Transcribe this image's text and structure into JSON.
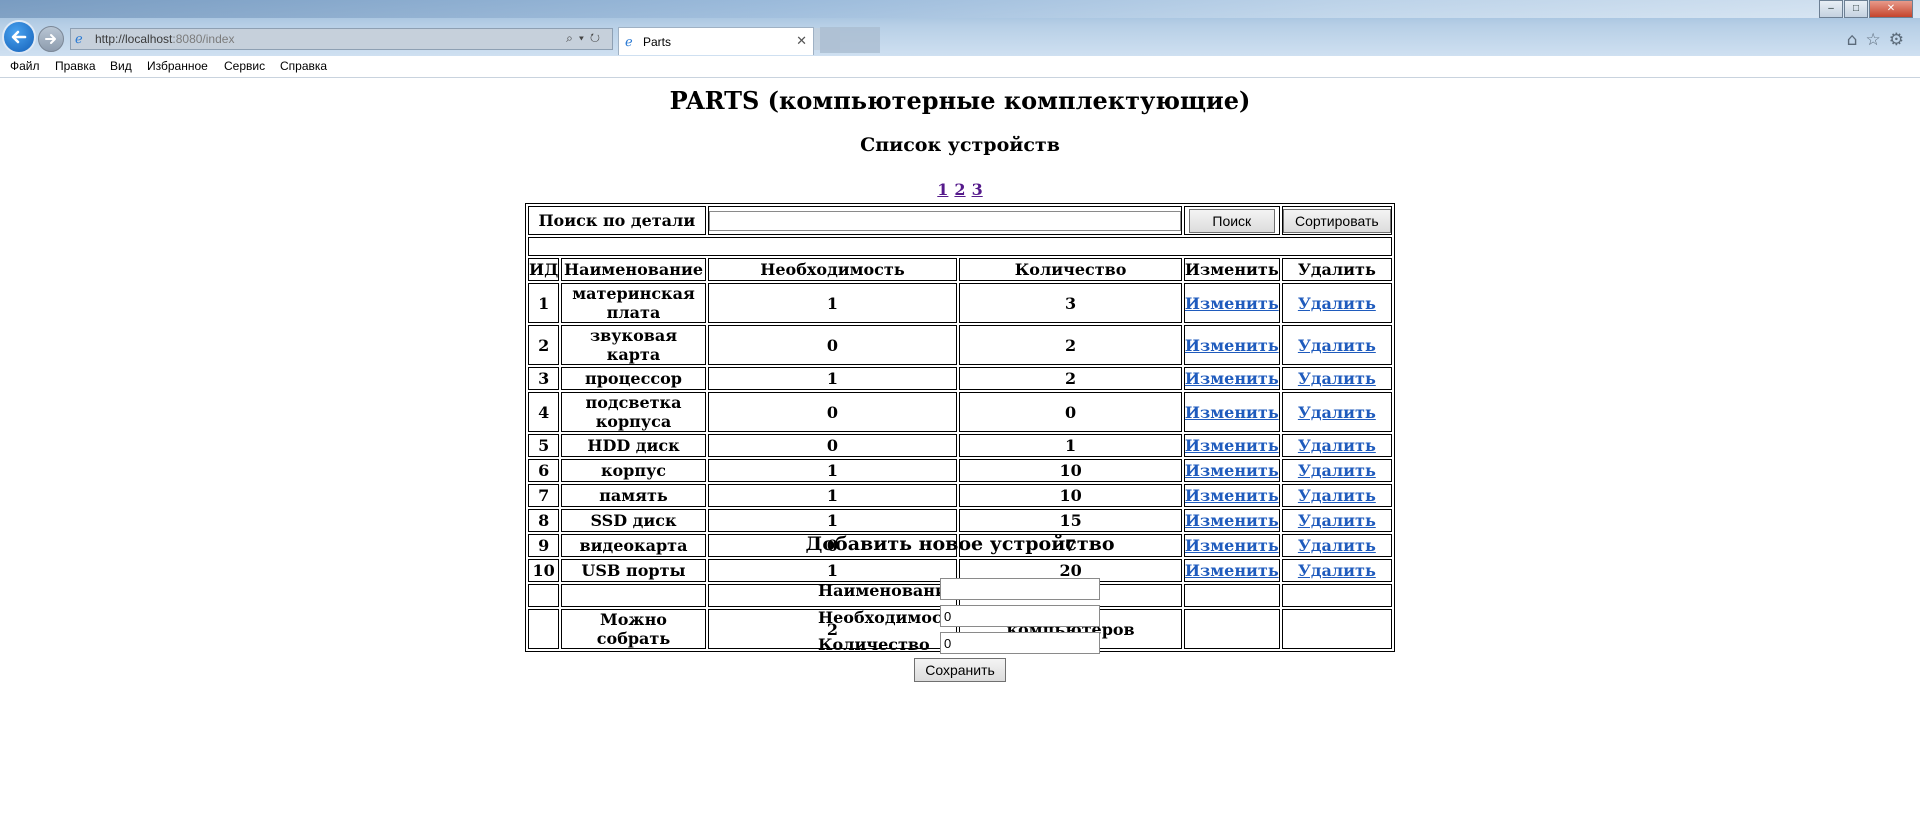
{
  "browser": {
    "url_host": "http://localhost",
    "url_path": ":8080/index",
    "tab_title": "Parts",
    "window_controls": [
      "–",
      "□",
      "✕"
    ],
    "menu": [
      "Файл",
      "Правка",
      "Вид",
      "Избранное",
      "Сервис",
      "Справка"
    ],
    "icons": [
      "back-arrow-icon",
      "forward-arrow-icon",
      "ie-logo-icon",
      "search-icon",
      "refresh-icon",
      "home-icon",
      "star-icon",
      "gear-icon",
      "close-icon"
    ]
  },
  "page": {
    "title": "PARTS (компьютерные комплектующие)",
    "subtitle": "Список устройств",
    "pages": [
      "1",
      "2",
      "3"
    ]
  },
  "search": {
    "label": "Поиск по детали",
    "value": "",
    "search_button": "Поиск",
    "sort_button": "Сортировать"
  },
  "table": {
    "headers": [
      "ИД",
      "Наименование",
      "Необходимость",
      "Количество",
      "Изменить",
      "Удалить"
    ],
    "edit_label": "Изменить",
    "delete_label": "Удалить",
    "rows": [
      {
        "id": "1",
        "name": "материнская плата",
        "need": "1",
        "qty": "3"
      },
      {
        "id": "2",
        "name": "звуковая карта",
        "need": "0",
        "qty": "2"
      },
      {
        "id": "3",
        "name": "процессор",
        "need": "1",
        "qty": "2"
      },
      {
        "id": "4",
        "name": "подсветка корпуса",
        "need": "0",
        "qty": "0"
      },
      {
        "id": "5",
        "name": "HDD диск",
        "need": "0",
        "qty": "1"
      },
      {
        "id": "6",
        "name": "корпус",
        "need": "1",
        "qty": "10"
      },
      {
        "id": "7",
        "name": "память",
        "need": "1",
        "qty": "10"
      },
      {
        "id": "8",
        "name": "SSD диск",
        "need": "1",
        "qty": "15"
      },
      {
        "id": "9",
        "name": "видеокарта",
        "need": "0",
        "qty": "7"
      },
      {
        "id": "10",
        "name": "USB порты",
        "need": "1",
        "qty": "20"
      }
    ],
    "summary": {
      "label": "Можно собрать",
      "count": "2",
      "unit": "компьютеров"
    }
  },
  "add_form": {
    "title": "Добавить новое устройство",
    "name_label": "Наименование",
    "name_value": "",
    "need_label": "Необходимость",
    "need_value": "0",
    "qty_label": "Количество",
    "qty_value": "0",
    "save_button": "Сохранить"
  },
  "colors": {
    "link": "#1f5bbd",
    "visited_link": "#551a8b",
    "chrome_blue": "#b7cfe6"
  }
}
